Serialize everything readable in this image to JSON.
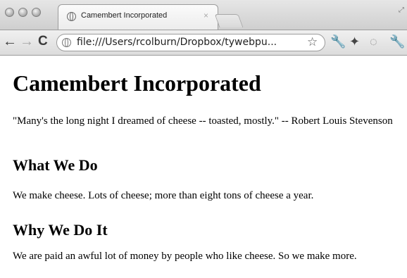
{
  "browser": {
    "tab_title": "Camembert Incorporated",
    "tab_close": "×",
    "url": "file:///Users/rcolburn/Dropbox/tywebpu...",
    "icons": {
      "back": "back-arrow-icon",
      "forward": "forward-arrow-icon",
      "reload": "reload-icon",
      "page": "globe-icon",
      "star": "star-icon"
    }
  },
  "page": {
    "title": "Camembert Incorporated",
    "quote": "\"Many's the long night I dreamed of cheese -- toasted, mostly.\" -- Robert Louis Stevenson",
    "sections": [
      {
        "heading": "What We Do",
        "text": "We make cheese. Lots of cheese; more than eight tons of cheese a year."
      },
      {
        "heading": "Why We Do It",
        "text": "We are paid an awful lot of money by people who like cheese. So we make more."
      }
    ]
  }
}
